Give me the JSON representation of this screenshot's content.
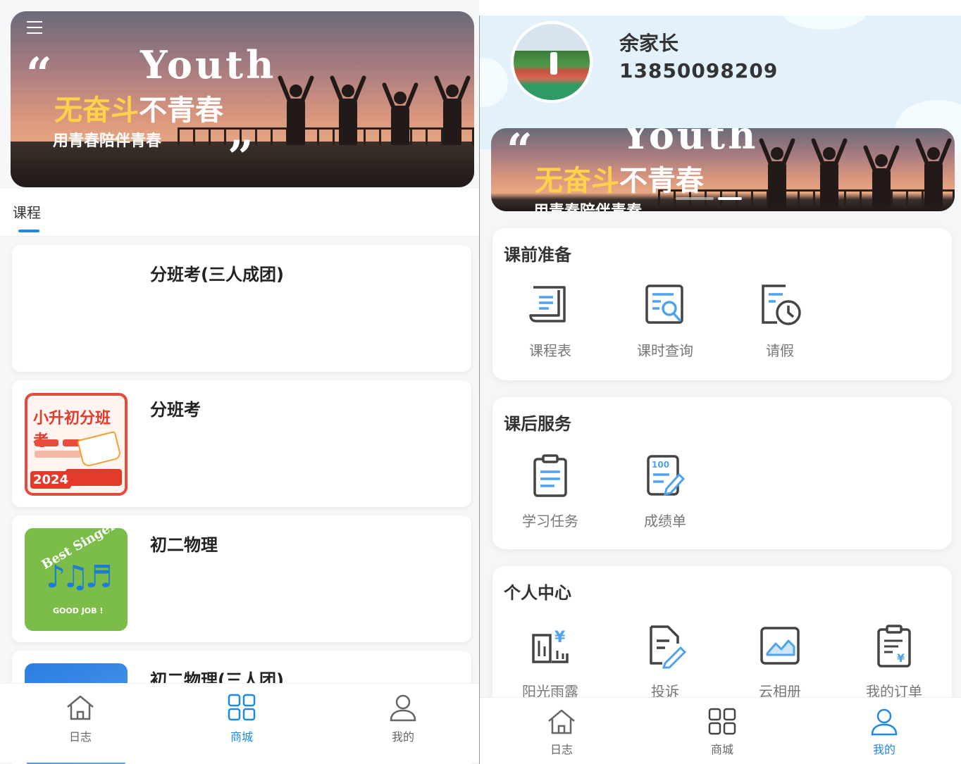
{
  "left": {
    "banner": {
      "quote_open": "“",
      "quote_close": "”",
      "headline_en": "Youth",
      "slogan_yellow": "无奋斗",
      "slogan_white": "不青春",
      "subtitle": "用青春陪伴青春"
    },
    "tabs": {
      "course": "课程"
    },
    "courses": [
      {
        "title": "分班考(三人成团)"
      },
      {
        "title": "分班考",
        "poster_title": "小升初分班考",
        "poster_year": "2024"
      },
      {
        "title": "初二物理",
        "badge_text": "Best Singer",
        "badge_sub": "GOOD JOB !"
      },
      {
        "title": "初二物理(三人团)"
      }
    ],
    "tabbar": {
      "items": [
        "日志",
        "商城",
        "我的"
      ],
      "active_index": 1
    }
  },
  "right": {
    "profile": {
      "name": "余家长",
      "phone": "13850098209"
    },
    "banner": {
      "quote_open": "“",
      "headline_en": "Youth",
      "slogan_yellow": "无奋斗",
      "slogan_white": "不青春",
      "subtitle": "用青春陪伴青春"
    },
    "sections": {
      "pre_class": {
        "title": "课前准备",
        "items": [
          "课程表",
          "课时查询",
          "请假"
        ]
      },
      "after_class": {
        "title": "课后服务",
        "items": [
          "学习任务",
          "成绩单"
        ]
      },
      "personal": {
        "title": "个人中心",
        "items": [
          "阳光雨露",
          "投诉",
          "云相册",
          "我的订单"
        ]
      }
    },
    "tabbar": {
      "items": [
        "日志",
        "商城",
        "我的"
      ],
      "active_index": 2
    }
  },
  "colors": {
    "accent": "#1e88e5",
    "icon_stroke": "#444444",
    "icon_accent": "#4da3f0",
    "slogan": "#ffd24a"
  }
}
